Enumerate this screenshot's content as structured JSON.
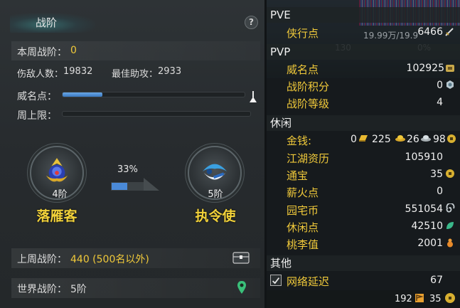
{
  "left": {
    "title": "战阶",
    "help": "?",
    "weekly_label": "本周战阶：",
    "weekly_value": "0",
    "defeated_label": "伤敌人数：",
    "defeated_value": "19832",
    "assist_label": "最佳助攻：",
    "assist_value": "2933",
    "prestige_label": "威名点：",
    "prestige_progress": 0.22,
    "weekly_cap_label": "周上限：",
    "weekly_cap_progress": 0.0,
    "percent": "33%",
    "percent_value": 0.33,
    "rank_current_tier": "4阶",
    "rank_current_name": "落雁客",
    "rank_next_tier": "5阶",
    "rank_next_name": "执令使",
    "last_week_label": "上周战阶：",
    "last_week_value": "440 (500名以外)",
    "world_label": "世界战阶：",
    "world_value": "5阶",
    "icons": [
      "chest-icon",
      "location-pin-icon"
    ]
  },
  "right": {
    "pve_head": "PVE",
    "pve_items": [
      {
        "label": "侠行点",
        "value": "6466",
        "icon": "sword-icon"
      }
    ],
    "pvp_head": "PVP",
    "pvp_items": [
      {
        "label": "威名点",
        "value": "102925",
        "icon": "coin-icon"
      },
      {
        "label": "战阶积分",
        "value": "0",
        "icon": "badge-icon"
      },
      {
        "label": "战阶等级",
        "value": "4"
      }
    ],
    "leisure_head": "休闲",
    "money": {
      "label": "金钱:",
      "gold_bars": "0",
      "gold": "225",
      "silver": "26",
      "copper": "98"
    },
    "leisure_items": [
      {
        "label": "江湖资历",
        "value": "105910"
      },
      {
        "label": "通宝",
        "value": "35",
        "icon": "coin-icon"
      },
      {
        "label": "薪火点",
        "value": "0"
      },
      {
        "label": "园宅币",
        "value": "551054",
        "icon": "spiral-icon"
      },
      {
        "label": "休闲点",
        "value": "42510",
        "icon": "leaf-icon"
      },
      {
        "label": "桃李值",
        "value": "2001",
        "icon": "gourd-icon"
      }
    ],
    "other_head": "其他",
    "latency_label": "网络延迟",
    "latency_value": "67",
    "bottom_left": "192",
    "bottom_right": "35",
    "bg_text": {
      "a": "19.99万/19.9",
      "b": "130",
      "c": "0%"
    }
  }
}
